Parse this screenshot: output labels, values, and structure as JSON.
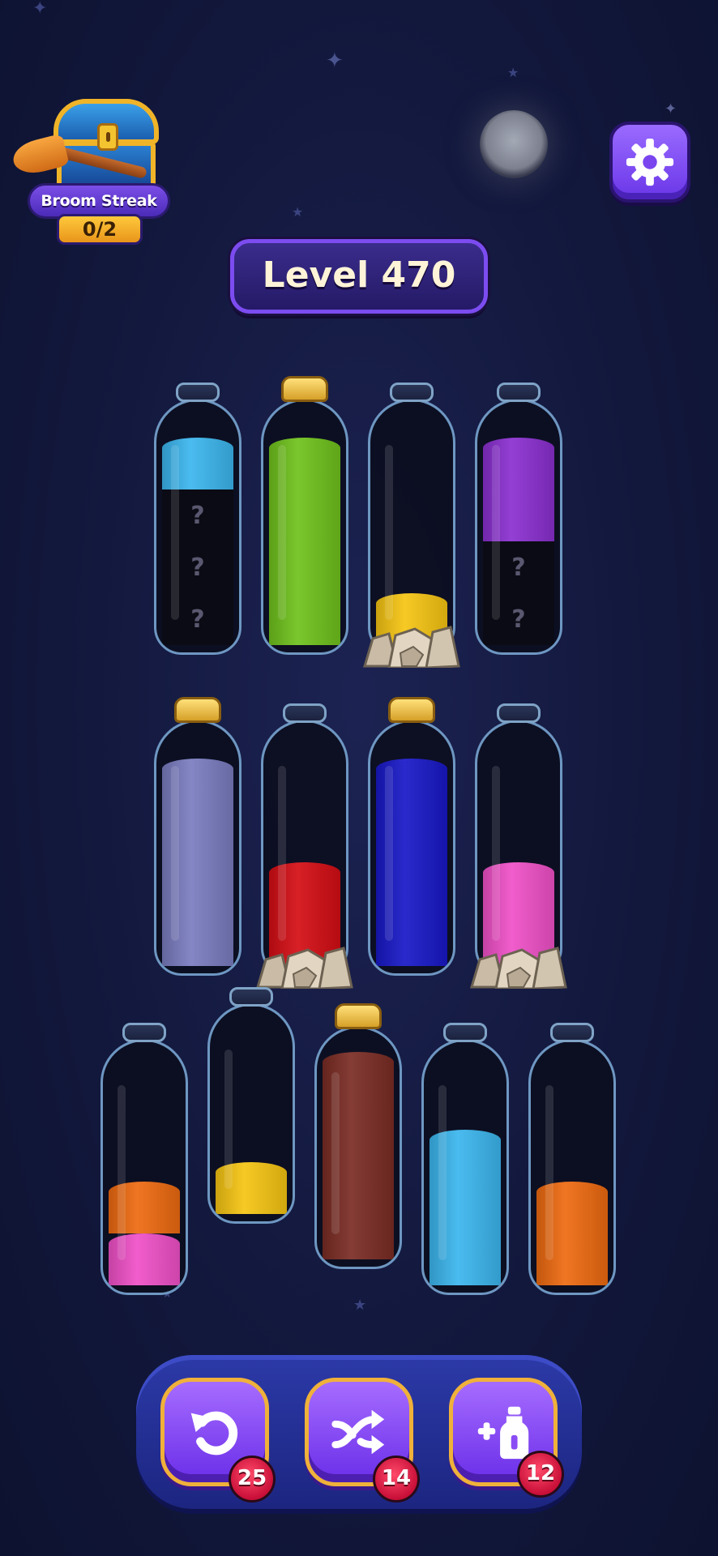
{
  "streak": {
    "title": "Broom Streak",
    "progress": "0/2",
    "icon": "treasure-chest-broom-icon"
  },
  "header": {
    "level_label": "Level 470",
    "settings_icon": "gear-icon"
  },
  "colors": {
    "cyan": "#3bb6ee",
    "green": "#6fc21c",
    "yellow": "#f6c512",
    "purple": "#8a2fd0",
    "lavender": "#7a7cc0",
    "red": "#d40d14",
    "blue": "#1818c8",
    "pink": "#f050c8",
    "orange": "#ee6a10",
    "brown": "#7a2c24",
    "hidden": "#0a0b14"
  },
  "rows": [
    {
      "bottles": [
        {
          "corked": false,
          "rocks": false,
          "layers": [
            {
              "color": "hidden",
              "label": "?"
            },
            {
              "color": "hidden",
              "label": "?"
            },
            {
              "color": "hidden",
              "label": "?"
            },
            {
              "color": "cyan"
            }
          ]
        },
        {
          "corked": true,
          "rocks": false,
          "layers": [
            {
              "color": "green"
            },
            {
              "color": "green"
            },
            {
              "color": "green"
            },
            {
              "color": "green"
            }
          ]
        },
        {
          "corked": false,
          "rocks": true,
          "layers": [
            {
              "color": "yellow"
            }
          ]
        },
        {
          "corked": false,
          "rocks": false,
          "layers": [
            {
              "color": "hidden",
              "label": "?"
            },
            {
              "color": "hidden",
              "label": "?"
            },
            {
              "color": "purple"
            },
            {
              "color": "purple"
            }
          ]
        }
      ]
    },
    {
      "bottles": [
        {
          "corked": true,
          "rocks": false,
          "layers": [
            {
              "color": "lavender"
            },
            {
              "color": "lavender"
            },
            {
              "color": "lavender"
            },
            {
              "color": "lavender"
            }
          ]
        },
        {
          "corked": false,
          "rocks": true,
          "layers": [
            {
              "color": "red"
            },
            {
              "color": "red"
            }
          ]
        },
        {
          "corked": true,
          "rocks": false,
          "layers": [
            {
              "color": "blue"
            },
            {
              "color": "blue"
            },
            {
              "color": "blue"
            },
            {
              "color": "blue"
            }
          ]
        },
        {
          "corked": false,
          "rocks": true,
          "layers": [
            {
              "color": "pink"
            },
            {
              "color": "pink"
            }
          ]
        }
      ]
    },
    {
      "bottles": [
        {
          "corked": false,
          "rocks": false,
          "layers": [
            {
              "color": "pink"
            },
            {
              "color": "orange"
            }
          ]
        },
        {
          "corked": false,
          "rocks": false,
          "layers": [
            {
              "color": "yellow"
            }
          ]
        },
        {
          "corked": true,
          "rocks": false,
          "layers": [
            {
              "color": "brown"
            },
            {
              "color": "brown"
            },
            {
              "color": "brown"
            },
            {
              "color": "brown"
            }
          ]
        },
        {
          "corked": false,
          "rocks": false,
          "layers": [
            {
              "color": "cyan"
            },
            {
              "color": "cyan"
            },
            {
              "color": "cyan"
            }
          ]
        },
        {
          "corked": false,
          "rocks": false,
          "layers": [
            {
              "color": "orange"
            },
            {
              "color": "orange"
            }
          ]
        }
      ]
    }
  ],
  "boosters": [
    {
      "name": "undo",
      "icon": "undo-icon",
      "count": "25"
    },
    {
      "name": "shuffle",
      "icon": "shuffle-icon",
      "count": "14"
    },
    {
      "name": "add-bottle",
      "icon": "add-bottle-icon",
      "count": "12"
    }
  ]
}
